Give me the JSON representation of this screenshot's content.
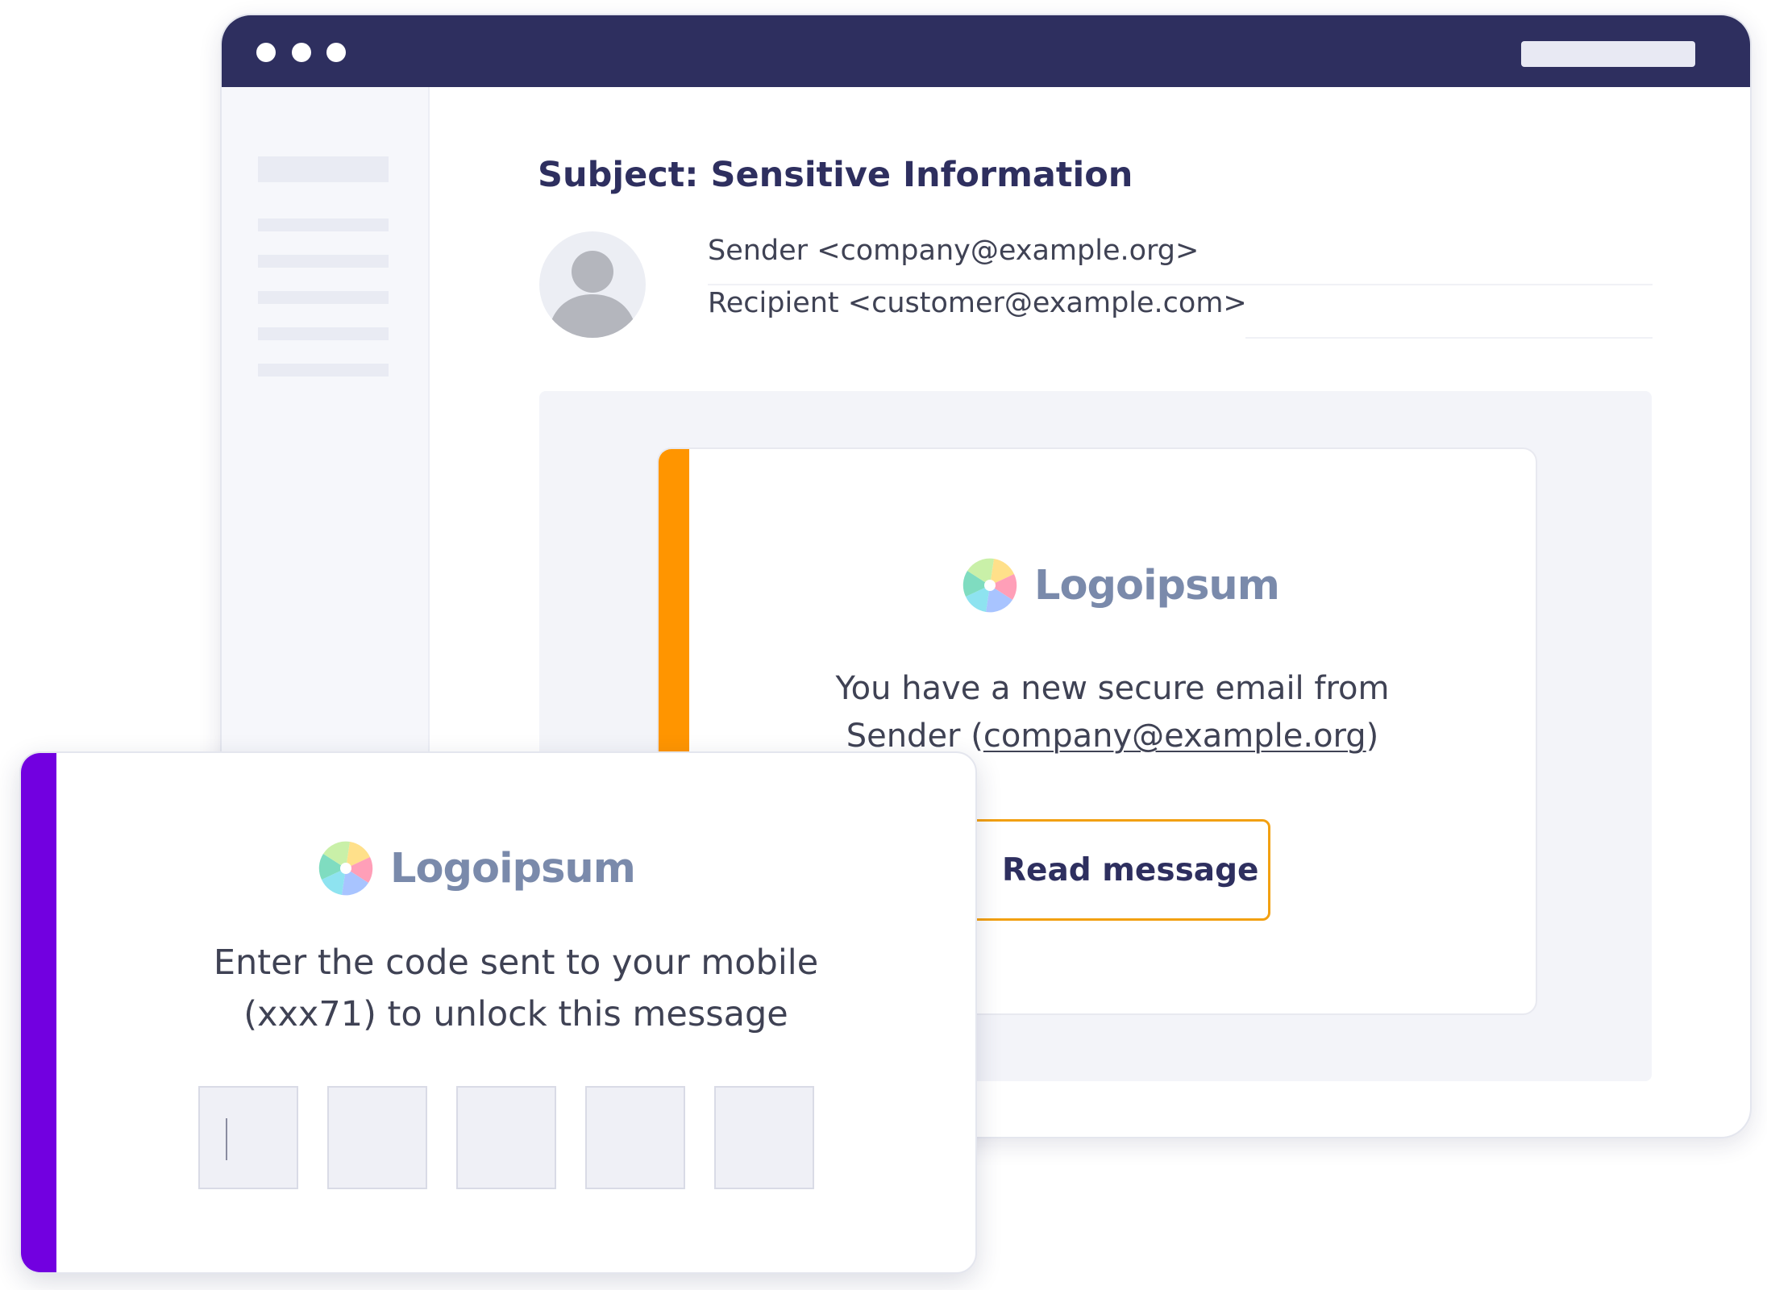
{
  "window": {
    "subject": "Subject: Sensitive Information",
    "sender": "Sender <company@example.org>",
    "recipient": "Recipient <customer@example.com>"
  },
  "email_card": {
    "logo_text": "Logoipsum",
    "message_line1": "You have a new secure email from",
    "message_sender_prefix": "Sender (",
    "message_sender_email": "company@example.org",
    "message_sender_suffix": ")",
    "button_label": "Read message"
  },
  "unlock_popup": {
    "logo_text": "Logoipsum",
    "message_line1": "Enter the code sent to your mobile",
    "message_line2": "(xxx71) to unlock this message",
    "code_digits": [
      "",
      "",
      "",
      "",
      ""
    ]
  },
  "colors": {
    "titlebar": "#2e2f5f",
    "heading": "#2e2f5f",
    "email_accent": "#ff9500",
    "button_border": "#f2a012",
    "popup_accent": "#7200e0",
    "logo_text": "#7a8aab"
  },
  "icons": [
    "window-dot-icon",
    "avatar-icon",
    "logo-mark-icon"
  ]
}
